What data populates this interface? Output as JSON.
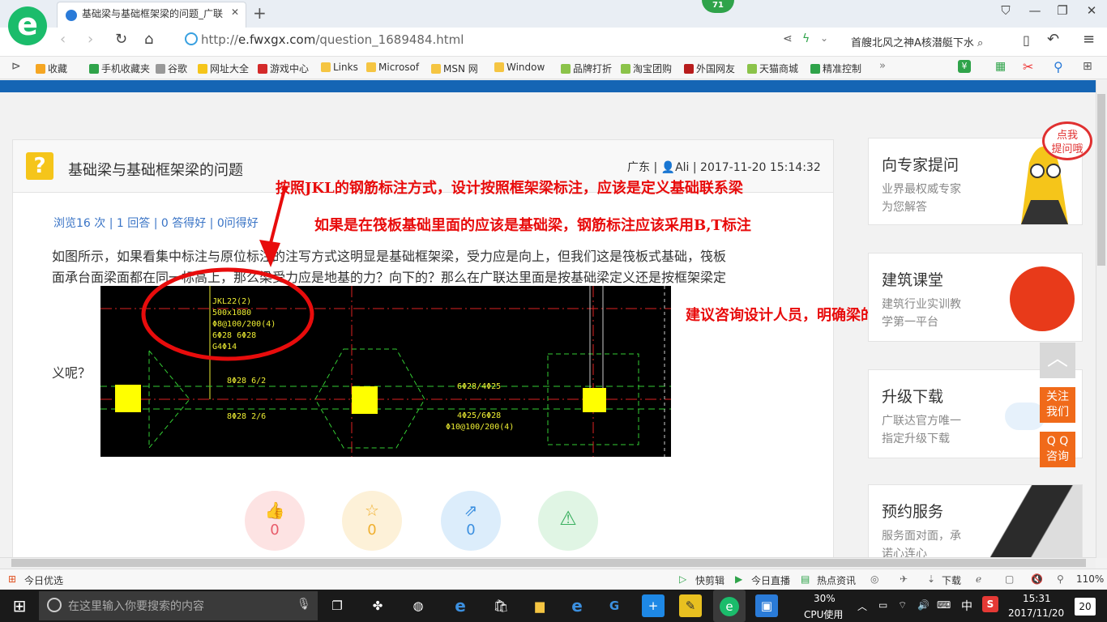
{
  "browser": {
    "tab_title": "基础梁与基础框架梁的问题_广联",
    "badge_count": "71",
    "url_prefix": "http://",
    "url_host": "e.fwxgx.com",
    "url_path": "/question_1689484.html",
    "news_ticker": "首艘北风之神A核潜艇下水"
  },
  "favorites": [
    {
      "label": "收藏",
      "icon_color": "#f5a623"
    },
    {
      "label": "手机收藏夹",
      "icon_color": "#2fa34a"
    },
    {
      "label": "谷歌",
      "icon_color": "#999999"
    },
    {
      "label": "网址大全",
      "icon_color": "#f5c51a"
    },
    {
      "label": "游戏中心",
      "icon_color": "#d42a2a"
    },
    {
      "label": "Links",
      "icon_color": "#f5c542"
    },
    {
      "label": "Microsof",
      "icon_color": "#f5c542"
    },
    {
      "label": "MSN 网",
      "icon_color": "#f5c542"
    },
    {
      "label": "Window",
      "icon_color": "#f5c542"
    },
    {
      "label": "品牌打折",
      "icon_color": "#8bc34a"
    },
    {
      "label": "淘宝团购",
      "icon_color": "#8bc34a"
    },
    {
      "label": "外国网友",
      "icon_color": "#b71c1c"
    },
    {
      "label": "天猫商城",
      "icon_color": "#8bc34a"
    },
    {
      "label": "精准控制",
      "icon_color": "#2fa34a"
    }
  ],
  "question": {
    "title": "基础梁与基础框架梁的问题",
    "region": "广东",
    "author": "Ali",
    "datetime": "2017-11-20 15:14:32",
    "stats": "浏览16 次 | 1 回答 | 0 答得好 | 0问得好",
    "body_line1": "如图所示，如果看集中标注与原位标注的注写方式这明显是基础框架梁，受力应是向上，但我们这是筏板式基础，筏板",
    "body_line2": "面承台面梁面都在同一标高上，那么梁受力应是地基的力？向下的？那么在广联达里面是按基础梁定义还是按框架梁定",
    "body_line3": "义呢？",
    "likes": "0",
    "favorites": "0",
    "shares": "0"
  },
  "annotations": {
    "note1": "按照JKL的钢筋标注方式，设计按照框架梁标注，应该是定义基础联系梁",
    "note2": "如果是在筏板基础里面的应该是基础梁，钢筋标注应该采用B,T标注",
    "note3": "建议咨询设计人员，明确梁的形式"
  },
  "cad": {
    "beam_label": [
      "JKL22(2)",
      "500x1080",
      "Φ8@100/200(4)",
      "6Φ28 6Φ28",
      "G4Φ14"
    ],
    "bottom_left_top": "8Φ28 6/2",
    "bottom_left_bot": "8Φ28 2/6",
    "right_top": "6Φ28/4Φ25",
    "right_bot1": "4Φ25/6Φ28",
    "right_bot2": "Φ10@100/200(4)"
  },
  "sidebar": [
    {
      "title": "向专家提问",
      "sub1": "业界最权威专家",
      "sub2": "为您解答",
      "bubble": "点我\n提问哦"
    },
    {
      "title": "建筑课堂",
      "sub1": "建筑行业实训教",
      "sub2": "学第一平台"
    },
    {
      "title": "升级下载",
      "sub1": "广联达官方唯一",
      "sub2": "指定升级下载"
    },
    {
      "title": "预约服务",
      "sub1": "服务面对面，承",
      "sub2": "诺心连心"
    }
  ],
  "float_buttons": {
    "follow": "关注\n我们",
    "qq": "Q Q\n咨询"
  },
  "statusbar": {
    "left": "今日优选",
    "items": [
      "快剪辑",
      "今日直播",
      "热点资讯",
      "下载"
    ],
    "zoom": "110%"
  },
  "taskbar": {
    "search_placeholder": "在这里输入你要搜索的内容",
    "cpu": "30%",
    "cpu_label": "CPU使用",
    "ime": "中",
    "time": "15:31",
    "date": "2017/11/20",
    "notify_count": "20"
  }
}
